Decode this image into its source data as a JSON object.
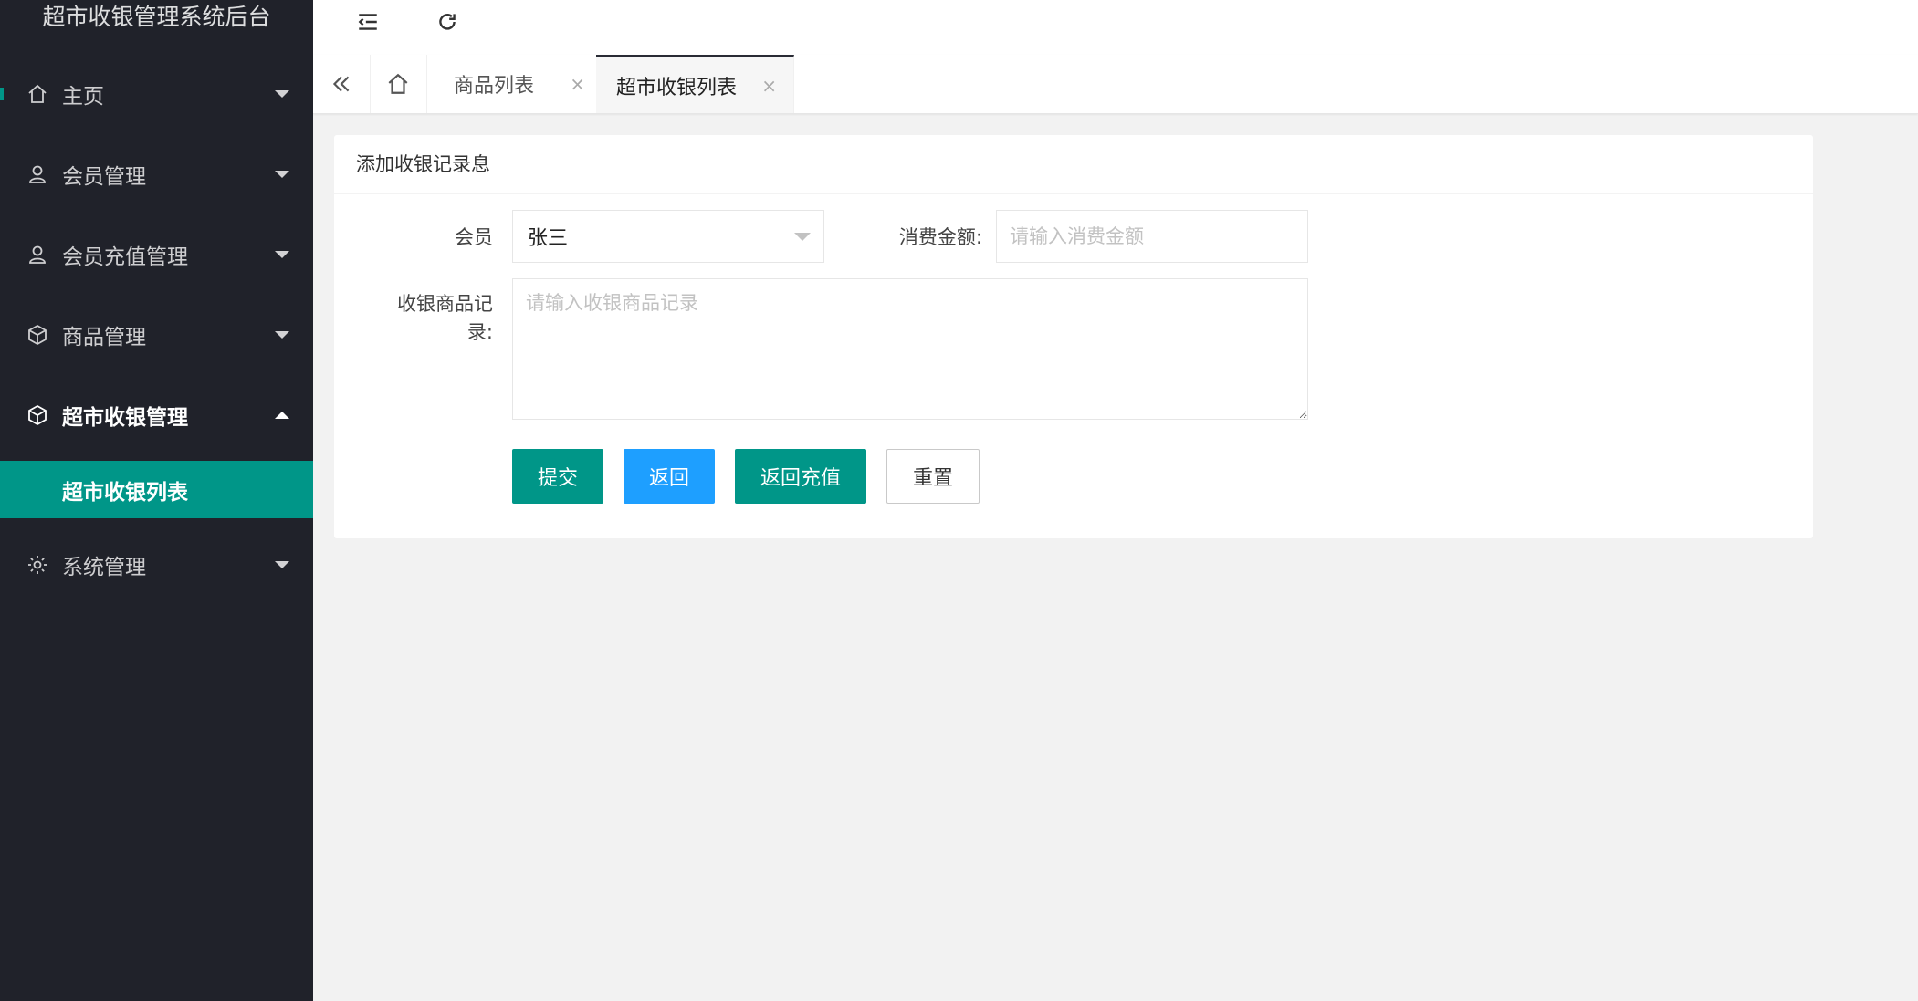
{
  "app": {
    "title": "超市收银管理系统后台"
  },
  "colors": {
    "sidebar": "#20222a",
    "accent": "#009688",
    "blue": "#1e9fff"
  },
  "sidebar": {
    "items": [
      {
        "label": "主页",
        "icon": "home-icon",
        "state": "collapsed"
      },
      {
        "label": "会员管理",
        "icon": "user-icon",
        "state": "collapsed"
      },
      {
        "label": "会员充值管理",
        "icon": "user-icon",
        "state": "collapsed"
      },
      {
        "label": "商品管理",
        "icon": "box-icon",
        "state": "collapsed"
      },
      {
        "label": "超市收银管理",
        "icon": "box-icon",
        "state": "expanded"
      },
      {
        "label": "系统管理",
        "icon": "gear-icon",
        "state": "collapsed"
      }
    ],
    "sub_item": {
      "label": "超市收银列表"
    }
  },
  "header": {
    "tools": [
      "collapse-menu-icon",
      "refresh-icon"
    ]
  },
  "tabs": [
    {
      "label": "商品列表",
      "active": false
    },
    {
      "label": "超市收银列表",
      "active": true
    }
  ],
  "tab_close": "×",
  "form": {
    "title": "添加收银记录息",
    "member_label": "会员",
    "member_value": "张三",
    "amount_label": "消费金额:",
    "amount_placeholder": "请输入消费金额",
    "record_label_line1": "收银商品记",
    "record_label_line2": "录:",
    "record_placeholder": "请输入收银商品记录",
    "buttons": {
      "submit": "提交",
      "back": "返回",
      "back_recharge": "返回充值",
      "reset": "重置"
    }
  }
}
